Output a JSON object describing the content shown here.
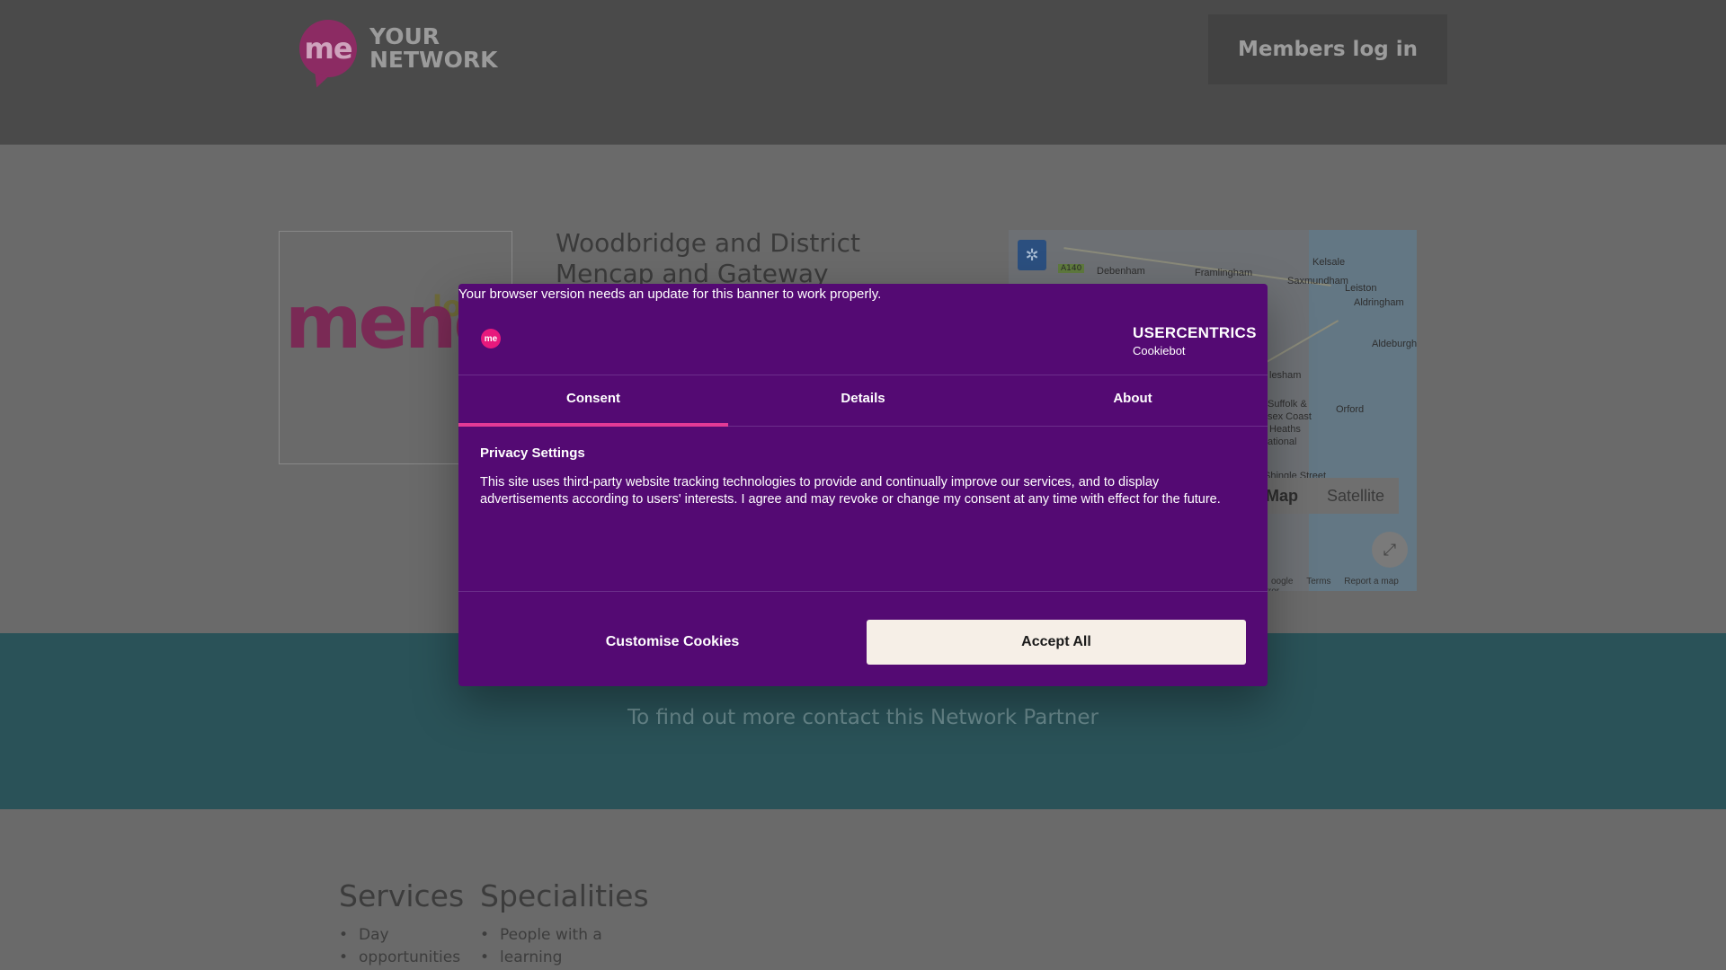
{
  "header": {
    "logo_mark": "me",
    "logo_line1": "YOUR",
    "logo_line2": "NETWORK",
    "members_label": "Members log in"
  },
  "partner": {
    "logo_word": "menca",
    "logo_small": "lo",
    "name": "Woodbridge and District Mencap and Gateway"
  },
  "map": {
    "labels": [
      "Debenham",
      "Framlingham",
      "Kelsale",
      "Saxmundham",
      "Leiston",
      "Aldringham",
      "Aldeburgh",
      "lesham",
      "Suffolk &",
      "sex Coast",
      "Heaths",
      "ational",
      "Orford",
      "Shingle Street"
    ],
    "road_badge": "A140",
    "toggle_map": "Map",
    "toggle_satellite": "Satellite",
    "footer_google": "oogle",
    "footer_terms": "Terms",
    "footer_report": "Report a map error"
  },
  "contact_band": {
    "text": "To find out more contact this Network Partner"
  },
  "services": {
    "heading": "Services",
    "items": [
      "Day",
      "opportunities"
    ]
  },
  "specialities": {
    "heading": "Specialities",
    "items": [
      "People with a",
      "learning"
    ]
  },
  "cookie_banner": {
    "warning": "Your browser version needs an update for this banner to work properly.",
    "brand_logo": "me",
    "provider_name": "USERCENTRICS",
    "provider_product": "Cookiebot",
    "tabs": [
      "Consent",
      "Details",
      "About"
    ],
    "active_tab": "Consent",
    "title": "Privacy Settings",
    "body": "This site uses third-party website tracking technologies to provide and continually improve our services, and to display advertisements according to users' interests. I agree and may revoke or change my consent at any time with effect for the future.",
    "customise_label": "Customise Cookies",
    "accept_label": "Accept All",
    "accent_color": "#e33a96",
    "background_color": "#540a73"
  }
}
